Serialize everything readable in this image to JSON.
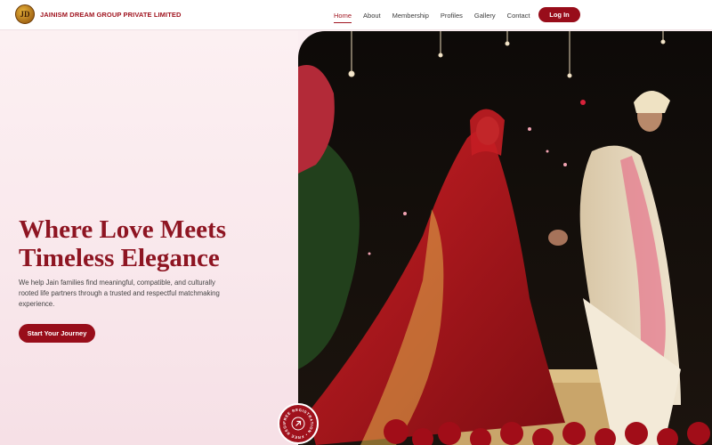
{
  "brand": {
    "name": "JAINISM DREAM GROUP PRIVATE LIMITED",
    "logo_text": "JD"
  },
  "nav": {
    "links": [
      "Home",
      "About",
      "Membership",
      "Profiles",
      "Gallery",
      "Contact"
    ],
    "active": "Home",
    "login_label": "Log In"
  },
  "hero": {
    "title_line1": "Where Love Meets",
    "title_line2": "Timeless Elegance",
    "subtitle": "We help Jain families find meaningful, compatible, and culturally rooted life partners through a trusted and respectful matchmaking experience.",
    "cta_label": "Start Your Journey"
  },
  "badge": {
    "text": "FREE REGISTRATION • FREE REGISTRATION •",
    "icon": "arrow-up-right-icon"
  },
  "colors": {
    "brand": "#980d1a",
    "title": "#8e1522",
    "background": "#fbeef1"
  }
}
